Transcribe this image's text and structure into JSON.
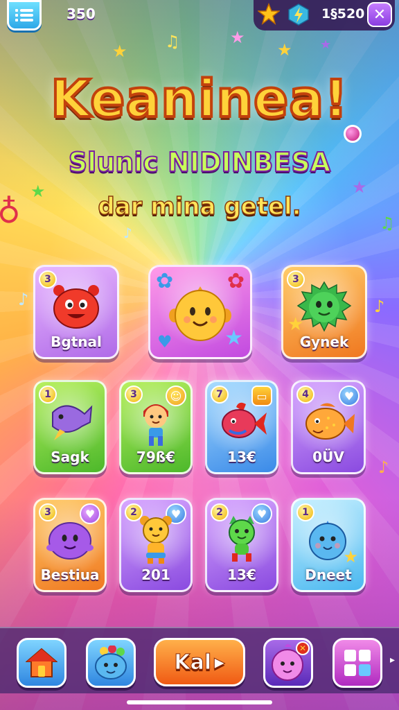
{
  "header": {
    "menu_icon": "menu-icon",
    "coins": "350",
    "star_icon": "star-icon",
    "bolt_icon": "bolt-gem-icon",
    "gems": "1§520",
    "close_label": "✕"
  },
  "hero": {
    "title": "Keaninea!",
    "subtitle": "Slunic NIDINBESA",
    "tagline": "dar mina getel."
  },
  "cards": [
    {
      "level": "3",
      "label": "Bgtnal",
      "color": "purple"
    },
    {
      "level": "",
      "label": "",
      "color": "magenta"
    },
    {
      "level": "3",
      "label": "Gynek",
      "color": "orange"
    },
    {
      "level": "1",
      "label": "Sagk",
      "color": "green"
    },
    {
      "level": "3",
      "label": "79ß€",
      "color": "green"
    },
    {
      "level": "7",
      "label": "13€",
      "color": "blue"
    },
    {
      "level": "4",
      "label": "0ÜV",
      "color": "violet"
    },
    {
      "level": "3",
      "label": "Bestiua",
      "color": "orange"
    },
    {
      "level": "2",
      "label": "201",
      "color": "violet"
    },
    {
      "level": "2",
      "label": "13€",
      "color": "violet"
    },
    {
      "level": "1",
      "label": "Dneet",
      "color": "sky"
    }
  ],
  "bottom_nav": {
    "home_icon": "house-icon",
    "pets_icon": "pet-creature-icon",
    "play_label": "Kal",
    "shop_icon": "creature-shop-icon",
    "grid_icon": "grid-icon",
    "more_arrow": "▸"
  },
  "colors": {
    "title_fill": "#ffd23a",
    "title_outline": "#c2410c",
    "subtitle_fill": "#c8ff5a",
    "play_button": "#f05a14"
  }
}
